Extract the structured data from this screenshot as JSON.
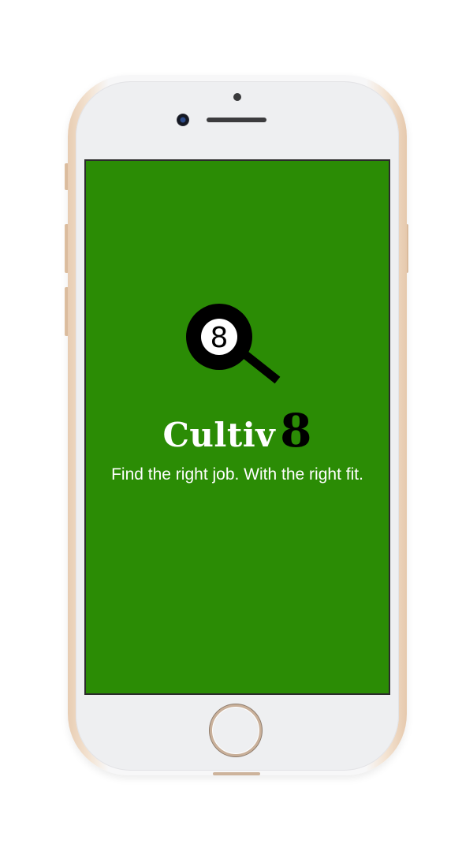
{
  "app": {
    "brand_word": "Cultiv",
    "brand_digit": "8",
    "tagline": "Find the right job. With the right fit.",
    "logo_ball_digit": "8"
  },
  "colors": {
    "screen_background": "#2b8c05",
    "brand_word": "#ffffff",
    "brand_digit": "#000000",
    "tagline": "#ffffff",
    "logo": "#000000"
  },
  "icons": {
    "logo": "magnifier-eight-ball-icon",
    "device_camera": "front-camera-icon",
    "device_home": "home-button-icon"
  }
}
